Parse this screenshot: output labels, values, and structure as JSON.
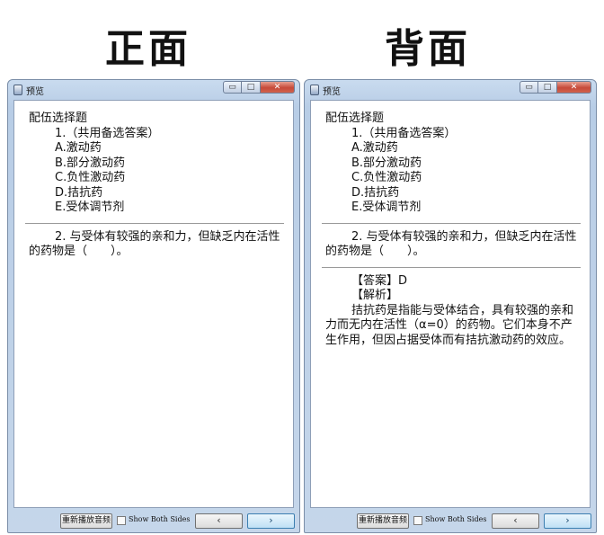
{
  "headings": {
    "front": "正面",
    "back": "背面"
  },
  "window": {
    "title": "预览",
    "minimize": "▭",
    "maximize": "□",
    "close": "✕"
  },
  "front": {
    "section_title": "配伍选择题",
    "question1": {
      "number_line": "1.（共用备选答案）",
      "options": [
        "A.激动药",
        "B.部分激动药",
        "C.负性激动药",
        "D.拮抗药",
        "E.受体调节剂"
      ]
    },
    "question2": "2. 与受体有较强的亲和力，但缺乏内在活性的药物是（　　）。"
  },
  "back": {
    "section_title": "配伍选择题",
    "question1": {
      "number_line": "1.（共用备选答案）",
      "options": [
        "A.激动药",
        "B.部分激动药",
        "C.负性激动药",
        "D.拮抗药",
        "E.受体调节剂"
      ]
    },
    "question2": "2. 与受体有较强的亲和力，但缺乏内在活性的药物是（　　）。",
    "answer_line": "【答案】D",
    "analysis_label": "【解析】",
    "analysis_text": "拮抗药是指能与受体结合，具有较强的亲和力而无内在活性（α=0）的药物。它们本身不产生作用，但因占据受体而有拮抗激动药的效应。"
  },
  "footer": {
    "replay_label": "重新播放音频",
    "show_both_label": "Show Both Sides",
    "prev_label": "‹",
    "next_label": "›"
  }
}
